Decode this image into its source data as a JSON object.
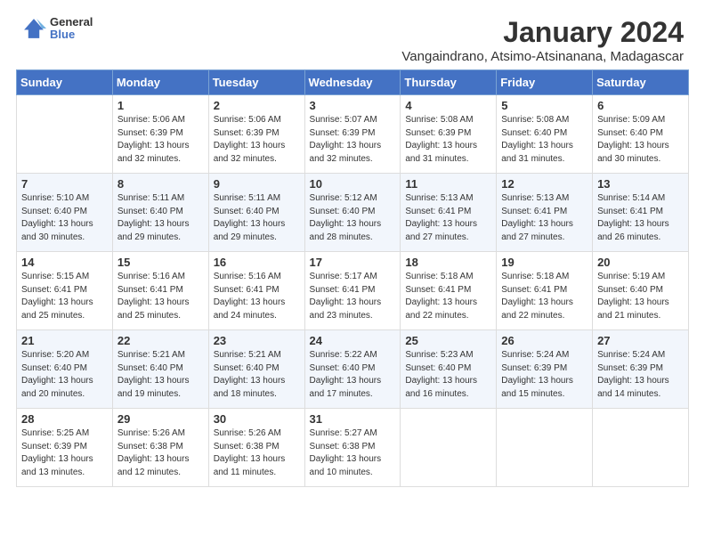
{
  "header": {
    "logo_text_line1": "General",
    "logo_text_line2": "Blue",
    "main_title": "January 2024",
    "subtitle": "Vangaindrano, Atsimo-Atsinanana, Madagascar"
  },
  "days_of_week": [
    "Sunday",
    "Monday",
    "Tuesday",
    "Wednesday",
    "Thursday",
    "Friday",
    "Saturday"
  ],
  "weeks": [
    [
      {
        "day": "",
        "info": ""
      },
      {
        "day": "1",
        "info": "Sunrise: 5:06 AM\nSunset: 6:39 PM\nDaylight: 13 hours\nand 32 minutes."
      },
      {
        "day": "2",
        "info": "Sunrise: 5:06 AM\nSunset: 6:39 PM\nDaylight: 13 hours\nand 32 minutes."
      },
      {
        "day": "3",
        "info": "Sunrise: 5:07 AM\nSunset: 6:39 PM\nDaylight: 13 hours\nand 32 minutes."
      },
      {
        "day": "4",
        "info": "Sunrise: 5:08 AM\nSunset: 6:39 PM\nDaylight: 13 hours\nand 31 minutes."
      },
      {
        "day": "5",
        "info": "Sunrise: 5:08 AM\nSunset: 6:40 PM\nDaylight: 13 hours\nand 31 minutes."
      },
      {
        "day": "6",
        "info": "Sunrise: 5:09 AM\nSunset: 6:40 PM\nDaylight: 13 hours\nand 30 minutes."
      }
    ],
    [
      {
        "day": "7",
        "info": "Sunrise: 5:10 AM\nSunset: 6:40 PM\nDaylight: 13 hours\nand 30 minutes."
      },
      {
        "day": "8",
        "info": "Sunrise: 5:11 AM\nSunset: 6:40 PM\nDaylight: 13 hours\nand 29 minutes."
      },
      {
        "day": "9",
        "info": "Sunrise: 5:11 AM\nSunset: 6:40 PM\nDaylight: 13 hours\nand 29 minutes."
      },
      {
        "day": "10",
        "info": "Sunrise: 5:12 AM\nSunset: 6:40 PM\nDaylight: 13 hours\nand 28 minutes."
      },
      {
        "day": "11",
        "info": "Sunrise: 5:13 AM\nSunset: 6:41 PM\nDaylight: 13 hours\nand 27 minutes."
      },
      {
        "day": "12",
        "info": "Sunrise: 5:13 AM\nSunset: 6:41 PM\nDaylight: 13 hours\nand 27 minutes."
      },
      {
        "day": "13",
        "info": "Sunrise: 5:14 AM\nSunset: 6:41 PM\nDaylight: 13 hours\nand 26 minutes."
      }
    ],
    [
      {
        "day": "14",
        "info": "Sunrise: 5:15 AM\nSunset: 6:41 PM\nDaylight: 13 hours\nand 25 minutes."
      },
      {
        "day": "15",
        "info": "Sunrise: 5:16 AM\nSunset: 6:41 PM\nDaylight: 13 hours\nand 25 minutes."
      },
      {
        "day": "16",
        "info": "Sunrise: 5:16 AM\nSunset: 6:41 PM\nDaylight: 13 hours\nand 24 minutes."
      },
      {
        "day": "17",
        "info": "Sunrise: 5:17 AM\nSunset: 6:41 PM\nDaylight: 13 hours\nand 23 minutes."
      },
      {
        "day": "18",
        "info": "Sunrise: 5:18 AM\nSunset: 6:41 PM\nDaylight: 13 hours\nand 22 minutes."
      },
      {
        "day": "19",
        "info": "Sunrise: 5:18 AM\nSunset: 6:41 PM\nDaylight: 13 hours\nand 22 minutes."
      },
      {
        "day": "20",
        "info": "Sunrise: 5:19 AM\nSunset: 6:40 PM\nDaylight: 13 hours\nand 21 minutes."
      }
    ],
    [
      {
        "day": "21",
        "info": "Sunrise: 5:20 AM\nSunset: 6:40 PM\nDaylight: 13 hours\nand 20 minutes."
      },
      {
        "day": "22",
        "info": "Sunrise: 5:21 AM\nSunset: 6:40 PM\nDaylight: 13 hours\nand 19 minutes."
      },
      {
        "day": "23",
        "info": "Sunrise: 5:21 AM\nSunset: 6:40 PM\nDaylight: 13 hours\nand 18 minutes."
      },
      {
        "day": "24",
        "info": "Sunrise: 5:22 AM\nSunset: 6:40 PM\nDaylight: 13 hours\nand 17 minutes."
      },
      {
        "day": "25",
        "info": "Sunrise: 5:23 AM\nSunset: 6:40 PM\nDaylight: 13 hours\nand 16 minutes."
      },
      {
        "day": "26",
        "info": "Sunrise: 5:24 AM\nSunset: 6:39 PM\nDaylight: 13 hours\nand 15 minutes."
      },
      {
        "day": "27",
        "info": "Sunrise: 5:24 AM\nSunset: 6:39 PM\nDaylight: 13 hours\nand 14 minutes."
      }
    ],
    [
      {
        "day": "28",
        "info": "Sunrise: 5:25 AM\nSunset: 6:39 PM\nDaylight: 13 hours\nand 13 minutes."
      },
      {
        "day": "29",
        "info": "Sunrise: 5:26 AM\nSunset: 6:38 PM\nDaylight: 13 hours\nand 12 minutes."
      },
      {
        "day": "30",
        "info": "Sunrise: 5:26 AM\nSunset: 6:38 PM\nDaylight: 13 hours\nand 11 minutes."
      },
      {
        "day": "31",
        "info": "Sunrise: 5:27 AM\nSunset: 6:38 PM\nDaylight: 13 hours\nand 10 minutes."
      },
      {
        "day": "",
        "info": ""
      },
      {
        "day": "",
        "info": ""
      },
      {
        "day": "",
        "info": ""
      }
    ]
  ]
}
